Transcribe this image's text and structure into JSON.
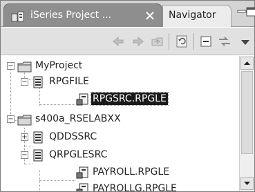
{
  "window": {
    "active_tab_label": "iSeries Project ...",
    "close_glyph": "✕",
    "inactive_tab_label": "Navigator"
  },
  "toolbar": {
    "buttons": [
      "back-arrow-icon",
      "forward-arrow-icon",
      "up-folder-icon",
      "refresh-icon",
      "collapse-all-icon",
      "link-with-editor-icon",
      "view-menu-icon"
    ]
  },
  "tree": {
    "items": [
      {
        "label": "MyProject",
        "expander": "−"
      },
      {
        "label": "RPGFILE",
        "expander": "−"
      },
      {
        "label": "RPGSRC.RPGLE"
      },
      {
        "label": "s400a_RSELABXX",
        "expander": "−"
      },
      {
        "label": "QDDSSRC",
        "expander": "+"
      },
      {
        "label": "QRPGLESRC",
        "expander": "−"
      },
      {
        "label": "PAYROLL.RPGLE"
      },
      {
        "label": "PAYROLLG.RPGLE"
      }
    ]
  },
  "colors": {
    "active_tab": "#8e8e8e",
    "selection": "#1a1a1a"
  }
}
